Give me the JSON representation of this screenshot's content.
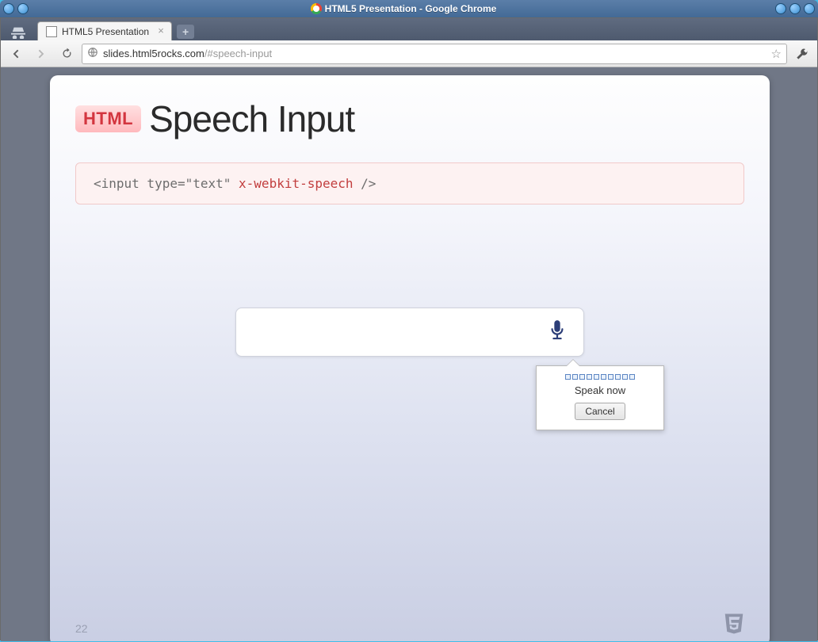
{
  "window": {
    "title": "HTML5 Presentation - Google Chrome"
  },
  "tab": {
    "label": "HTML5 Presentation"
  },
  "omnibox": {
    "domain": "slides.html5rocks.com",
    "path": "/#speech-input"
  },
  "slide": {
    "badge": "HTML",
    "title": "Speech Input",
    "code_plain": "<input type=\"text\" ",
    "code_attr": "x-webkit-speech",
    "code_tail": " />",
    "page_number": "22"
  },
  "popup": {
    "message": "Speak now",
    "cancel": "Cancel"
  }
}
